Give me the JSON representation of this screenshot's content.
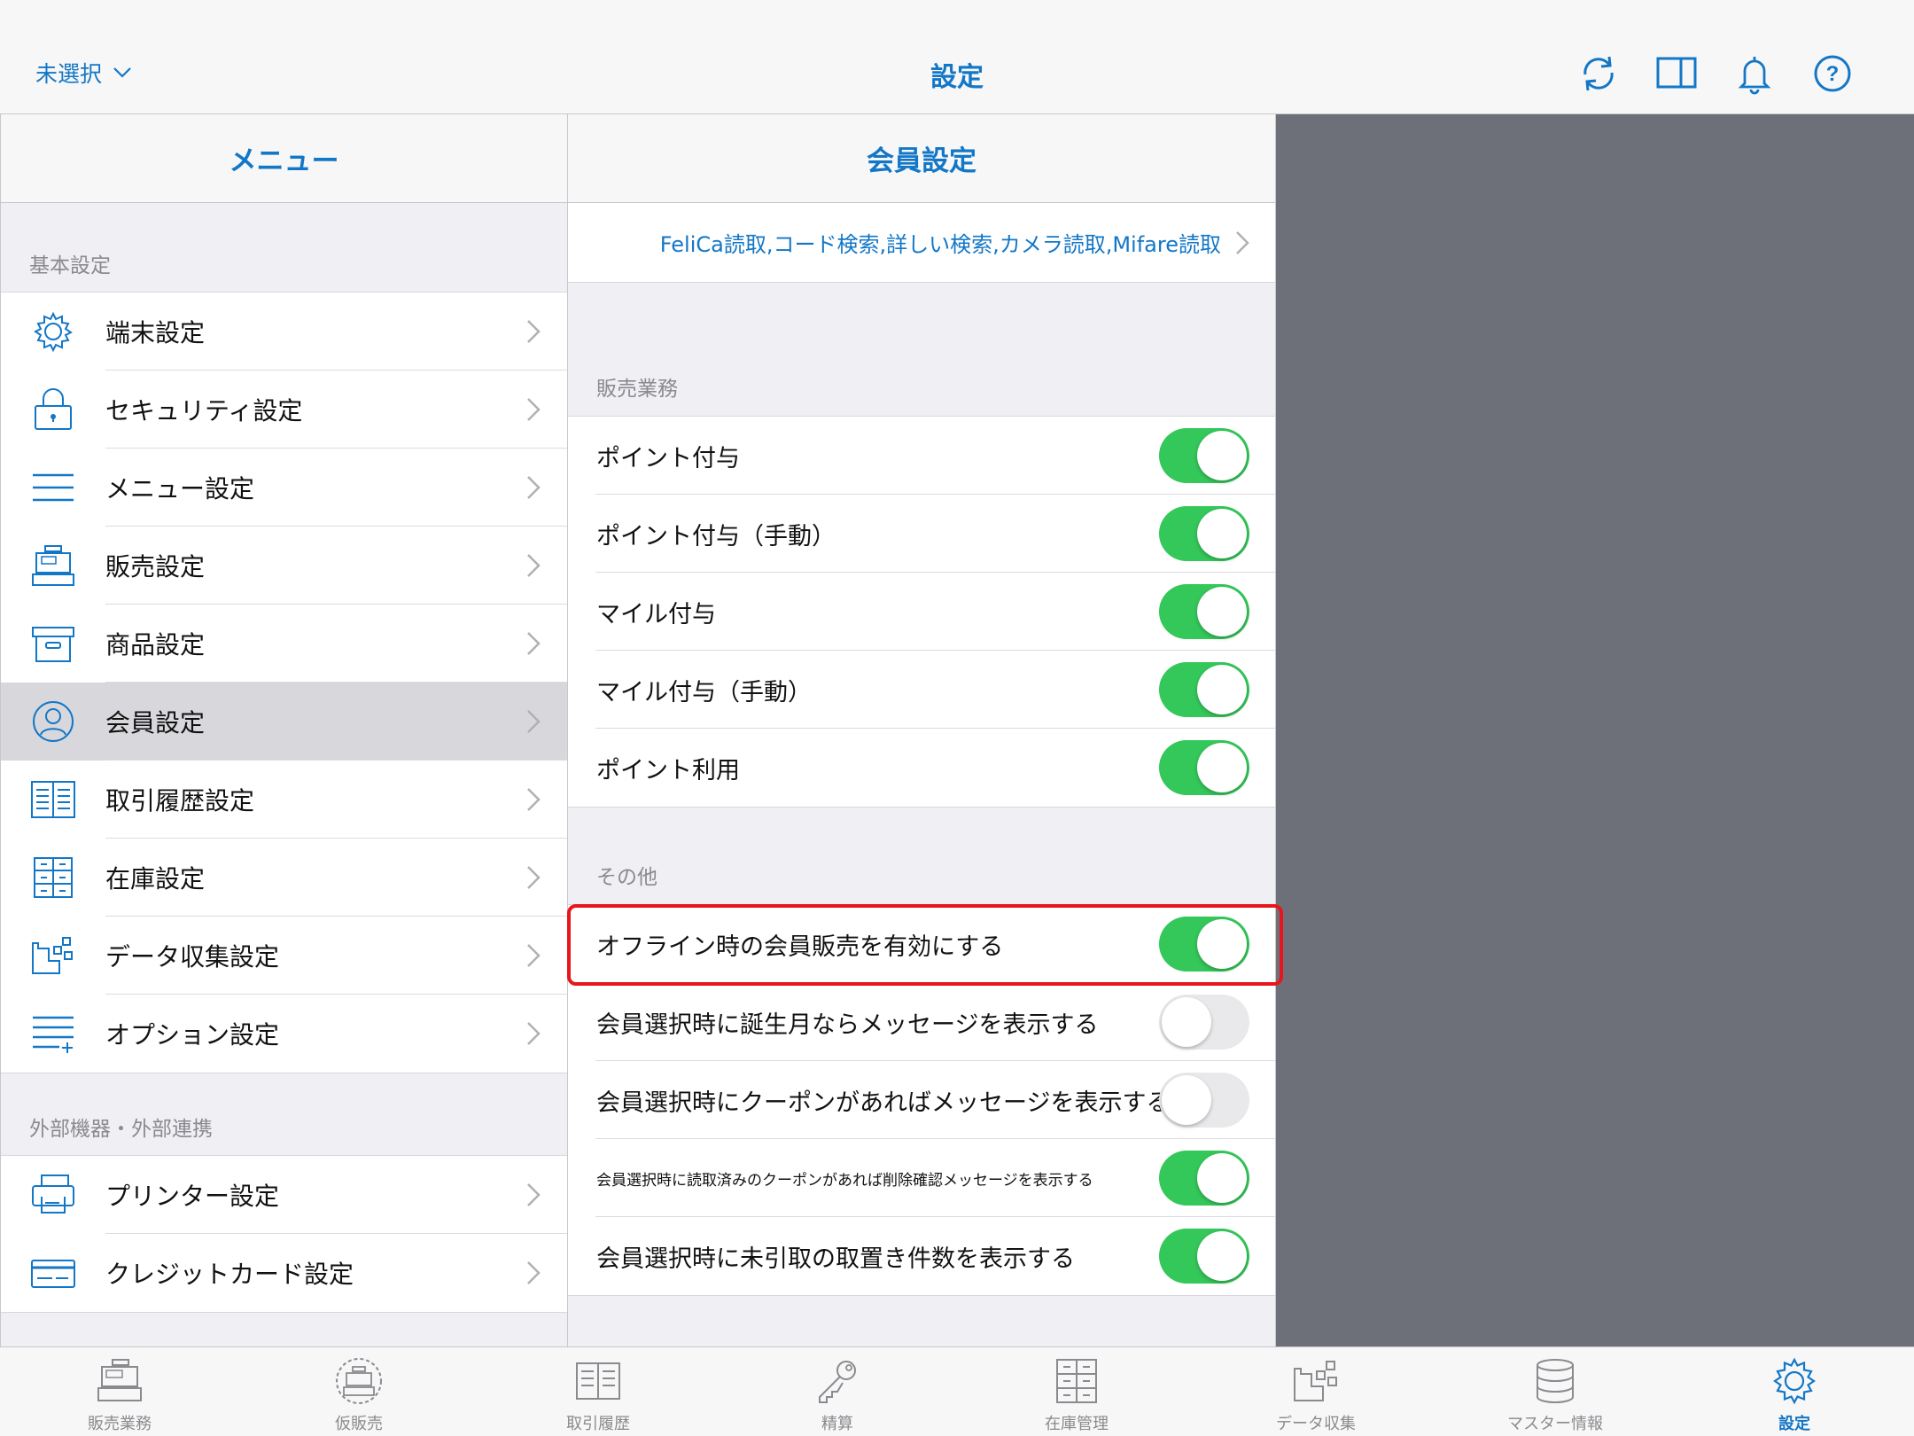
{
  "nav": {
    "store_select": "未選択",
    "title": "設定",
    "icons": [
      "refresh-icon",
      "split-view-icon",
      "bell-icon",
      "help-icon"
    ]
  },
  "left_pane": {
    "title": "メニュー",
    "section_basic": "基本設定",
    "items": [
      {
        "label": "端末設定",
        "icon": "gear-icon"
      },
      {
        "label": "セキュリティ設定",
        "icon": "lock-icon"
      },
      {
        "label": "メニュー設定",
        "icon": "menu-lines-icon"
      },
      {
        "label": "販売設定",
        "icon": "register-icon"
      },
      {
        "label": "商品設定",
        "icon": "box-icon"
      },
      {
        "label": "会員設定",
        "icon": "person-icon",
        "selected": true
      },
      {
        "label": "取引履歴設定",
        "icon": "book-icon"
      },
      {
        "label": "在庫設定",
        "icon": "cabinet-icon"
      },
      {
        "label": "データ収集設定",
        "icon": "data-collect-icon"
      },
      {
        "label": "オプション設定",
        "icon": "option-list-icon"
      }
    ],
    "section_external": "外部機器・外部連携",
    "external_items": [
      {
        "label": "プリンター設定",
        "icon": "printer-icon"
      },
      {
        "label": "クレジットカード設定",
        "icon": "credit-card-icon"
      }
    ]
  },
  "mid_pane": {
    "title": "会員設定",
    "search_methods": "FeliCa読取,コード検索,詳しい検索,カメラ読取,Mifare読取",
    "section_sales": "販売業務",
    "sales_settings": [
      {
        "label": "ポイント付与",
        "on": true
      },
      {
        "label": "ポイント付与（手動）",
        "on": true
      },
      {
        "label": "マイル付与",
        "on": true
      },
      {
        "label": "マイル付与（手動）",
        "on": true
      },
      {
        "label": "ポイント利用",
        "on": true
      }
    ],
    "section_other": "その他",
    "other_settings": [
      {
        "label": "オフライン時の会員販売を有効にする",
        "on": true,
        "highlighted": true
      },
      {
        "label": "会員選択時に誕生月ならメッセージを表示する",
        "on": false
      },
      {
        "label": "会員選択時にクーポンがあればメッセージを表示する",
        "on": false
      },
      {
        "label": "会員選択時に読取済みのクーポンがあれば削除確認メッセージを表示する",
        "on": true
      },
      {
        "label": "会員選択時に未引取の取置き件数を表示する",
        "on": true
      }
    ]
  },
  "tabbar": {
    "tabs": [
      {
        "label": "販売業務",
        "icon": "register-icon"
      },
      {
        "label": "仮販売",
        "icon": "temp-sale-icon"
      },
      {
        "label": "取引履歴",
        "icon": "book-icon"
      },
      {
        "label": "精算",
        "icon": "key-icon"
      },
      {
        "label": "在庫管理",
        "icon": "cabinet-icon"
      },
      {
        "label": "データ収集",
        "icon": "data-collect-icon"
      },
      {
        "label": "マスター情報",
        "icon": "database-icon"
      },
      {
        "label": "設定",
        "icon": "gear-icon",
        "active": true
      }
    ]
  },
  "colors": {
    "accent": "#1377c7",
    "toggle_on": "#34c759",
    "toggle_off": "#e9e9eb",
    "highlight": "#e8161c",
    "detail_bg": "#6e7079"
  }
}
